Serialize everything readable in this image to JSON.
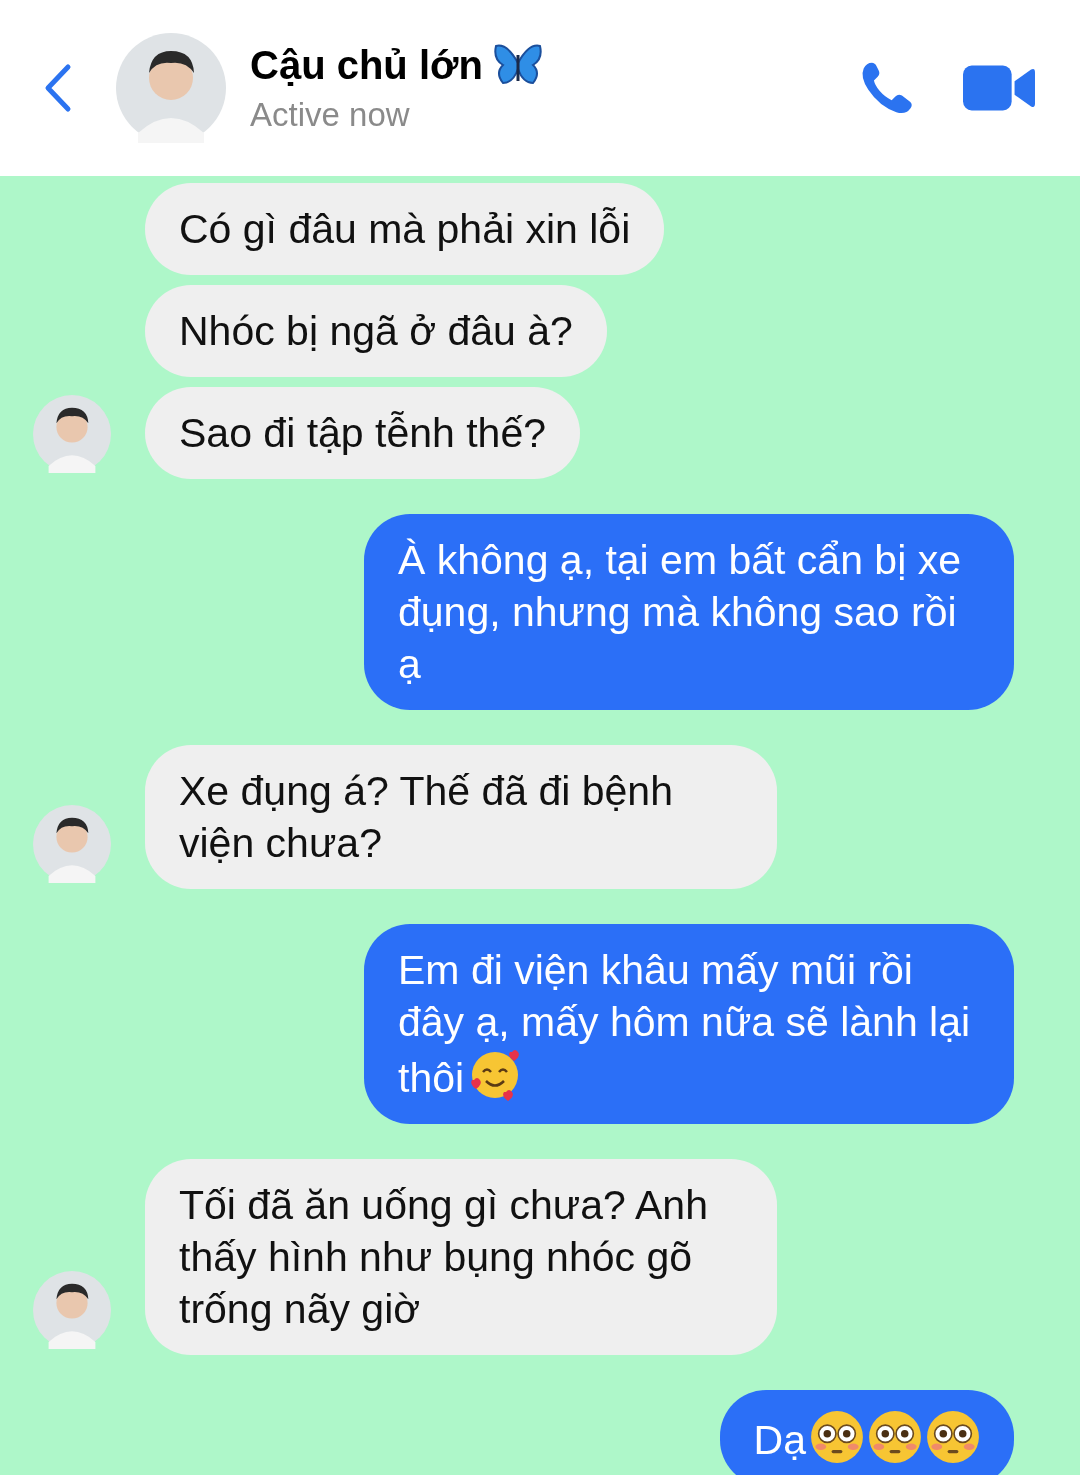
{
  "header": {
    "name": "Cậu chủ lớn",
    "status": "Active now"
  },
  "messages": [
    {
      "kind": "incoming",
      "text": "Có gì đâu mà phải xin lỗi",
      "avatar": false
    },
    {
      "kind": "incoming",
      "text": "Nhóc bị ngã ở đâu à?",
      "avatar": false
    },
    {
      "kind": "incoming",
      "text": "Sao đi tập tễnh thế?",
      "avatar": true
    },
    {
      "kind": "outgoing",
      "text": "À không ạ, tại em bất cẩn bị xe đụng, nhưng mà không sao rồi ạ"
    },
    {
      "kind": "incoming",
      "text": "Xe đụng á? Thế đã đi bệnh viện chưa?",
      "avatar": true
    },
    {
      "kind": "outgoing",
      "text": "Em đi viện khâu mấy mũi rồi đây ạ, mấy hôm nữa sẽ lành lại thôi",
      "emojis": [
        {
          "kind": "hearts"
        }
      ]
    },
    {
      "kind": "incoming",
      "text": "Tối đã ăn uống gì chưa? Anh thấy hình như bụng nhóc gõ trống nãy giờ",
      "avatar": true
    },
    {
      "kind": "outgoing",
      "text": "Dạ",
      "emojis": [
        {
          "kind": "flushed"
        },
        {
          "kind": "flushed"
        },
        {
          "kind": "flushed"
        }
      ]
    }
  ]
}
